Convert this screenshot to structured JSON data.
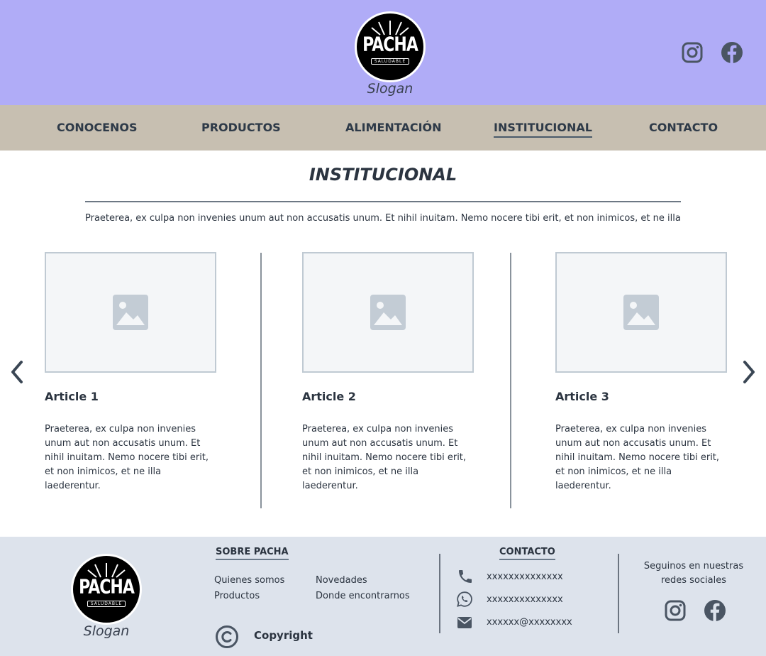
{
  "header": {
    "logo_text": "PACHA",
    "logo_subtext": "SALUDABLE",
    "slogan": "Slogan",
    "social_icons": [
      "instagram-icon",
      "facebook-icon"
    ]
  },
  "nav": {
    "items": [
      {
        "label": "CONOCENOS"
      },
      {
        "label": "PRODUCTOS"
      },
      {
        "label": "ALIMENTACIÓN"
      },
      {
        "label": "INSTITUCIONAL"
      },
      {
        "label": "CONTACTO"
      }
    ],
    "active": "INSTITUCIONAL"
  },
  "main": {
    "title": "INSTITUCIONAL",
    "intro": "Praeterea, ex culpa non invenies unum aut non accusatis unum. Et nihil inuitam. Nemo nocere tibi erit, et non inimicos, et ne illa",
    "articles": [
      {
        "title": "Article 1",
        "text": "Praeterea, ex culpa non invenies unum aut non accusatis unum. Et nihil inuitam. Nemo nocere tibi erit, et non inimicos, et ne illa laederentur."
      },
      {
        "title": "Article 2",
        "text": "Praeterea, ex culpa non invenies unum aut non accusatis unum. Et nihil inuitam. Nemo nocere tibi erit, et non inimicos, et ne illa laederentur."
      },
      {
        "title": "Article 3",
        "text": "Praeterea, ex culpa non invenies unum aut non accusatis unum. Et nihil inuitam. Nemo nocere tibi erit, et non inimicos, et ne illa laederentur."
      }
    ],
    "carousel_icons": [
      "chevron-left-icon",
      "chevron-right-icon"
    ]
  },
  "footer": {
    "logo_text": "PACHA",
    "logo_subtext": "SALUDABLE",
    "slogan": "Slogan",
    "about": {
      "heading": "SOBRE PACHA",
      "links": [
        "Quienes somos",
        "Productos",
        "Novedades",
        "Donde encontrarnos"
      ]
    },
    "copyright": "Copyright",
    "contact": {
      "heading": "CONTACTO",
      "phone": "xxxxxxxxxxxxxx",
      "whatsapp": "xxxxxxxxxxxxxx",
      "email": "xxxxxx@xxxxxxxx"
    },
    "follow_line1": "Seguinos en nuestras",
    "follow_line2": "redes sociales"
  },
  "colors": {
    "header_bg": "#b0acf7",
    "nav_bg": "#c7bfb1",
    "footer_bg": "#dde3ec",
    "text": "#2b3440",
    "icon": "#4a5563"
  }
}
